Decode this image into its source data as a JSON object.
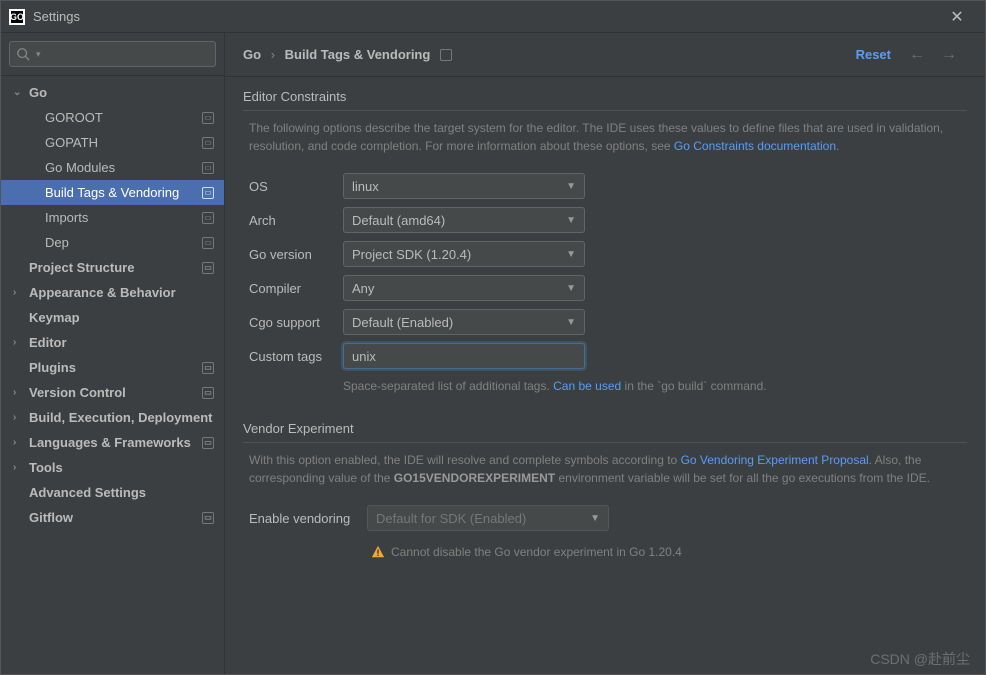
{
  "window": {
    "title": "Settings"
  },
  "search": {
    "placeholder": ""
  },
  "tree": {
    "go": "Go",
    "goroot": "GOROOT",
    "gopath": "GOPATH",
    "gomodules": "Go Modules",
    "buildtags": "Build Tags & Vendoring",
    "imports": "Imports",
    "dep": "Dep",
    "projstruct": "Project Structure",
    "appearance": "Appearance & Behavior",
    "keymap": "Keymap",
    "editor": "Editor",
    "plugins": "Plugins",
    "vcs": "Version Control",
    "build": "Build, Execution, Deployment",
    "langs": "Languages & Frameworks",
    "tools": "Tools",
    "advanced": "Advanced Settings",
    "gitflow": "Gitflow"
  },
  "header": {
    "crumb1": "Go",
    "crumb2": "Build Tags & Vendoring",
    "reset": "Reset"
  },
  "editor_constraints": {
    "title": "Editor Constraints",
    "desc1": "The following options describe the target system for the editor. The IDE uses these values to define files that are used in validation, resolution, and code completion. For more information about these options, see ",
    "link1": "Go Constraints documentation",
    "fields": {
      "os_label": "OS",
      "os_value": "linux",
      "arch_label": "Arch",
      "arch_value": "Default (amd64)",
      "gover_label": "Go version",
      "gover_value": "Project SDK (1.20.4)",
      "compiler_label": "Compiler",
      "compiler_value": "Any",
      "cgo_label": "Cgo support",
      "cgo_value": "Default (Enabled)",
      "tags_label": "Custom tags",
      "tags_value": "unix"
    },
    "hint1": "Space-separated list of additional tags. ",
    "hint_link": "Can be used",
    "hint2": " in the `go build` command."
  },
  "vendor": {
    "title": "Vendor Experiment",
    "desc1": "With this option enabled, the IDE will resolve and complete symbols according to ",
    "link1": "Go Vendoring Experiment Proposal",
    "desc2": ". Also, the corresponding value of the ",
    "bold": "GO15VENDOREXPERIMENT",
    "desc3": " environment variable will be set for all the go executions from the IDE.",
    "enable_label": "Enable vendoring",
    "enable_value": "Default for SDK (Enabled)",
    "warn": "Cannot disable the Go vendor experiment in Go 1.20.4"
  },
  "watermark": "CSDN @赴前尘"
}
